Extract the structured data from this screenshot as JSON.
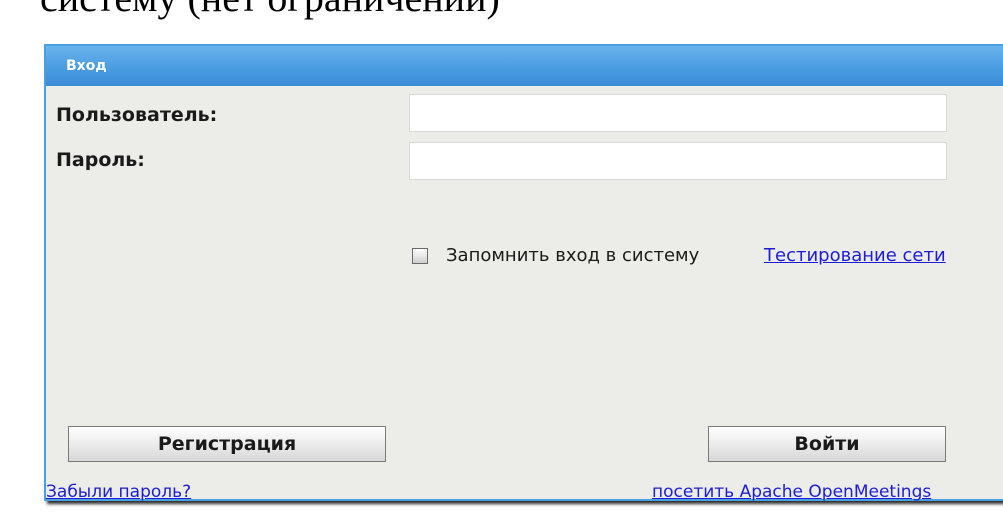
{
  "background_text": "систему (нет ограничений)",
  "dialog": {
    "title": "Вход",
    "username_label": "Пользователь:",
    "username_value": "",
    "password_label": "Пароль:",
    "password_value": "",
    "remember_label": "Запомнить вход в систему",
    "remember_checked": false,
    "network_test_link": "Тестирование сети",
    "register_button": "Регистрация",
    "login_button": "Войти",
    "forgot_password_link": "Забыли пароль?",
    "visit_link": "посетить Apache OpenMeetings"
  },
  "colors": {
    "title_bar": "#4a9ce0",
    "dialog_bg": "#ecece8",
    "link": "#1c1cd8"
  }
}
